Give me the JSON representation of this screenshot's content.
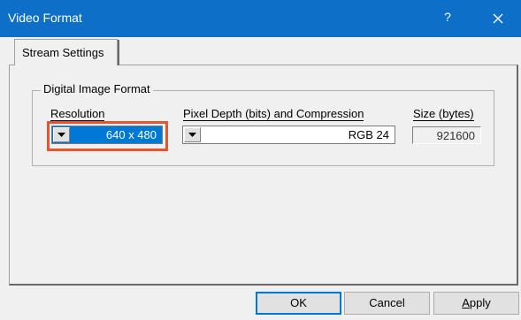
{
  "window": {
    "title": "Video Format",
    "help_label": "?"
  },
  "tabs": [
    {
      "label": "Stream Settings",
      "selected": true
    }
  ],
  "group": {
    "label": "Digital Image Format",
    "resolution": {
      "label": "Resolution",
      "value": "640 x 480"
    },
    "pixel_depth": {
      "label": "Pixel Depth (bits) and Compression",
      "value": "RGB 24"
    },
    "size": {
      "label": "Size (bytes)",
      "value": "921600"
    }
  },
  "buttons": {
    "ok": "OK",
    "cancel": "Cancel",
    "apply_first": "A",
    "apply_rest": "pply"
  },
  "colors": {
    "titlebar": "#0d6fc8",
    "selection": "#0078d7",
    "highlight_outline": "#e8542e"
  }
}
